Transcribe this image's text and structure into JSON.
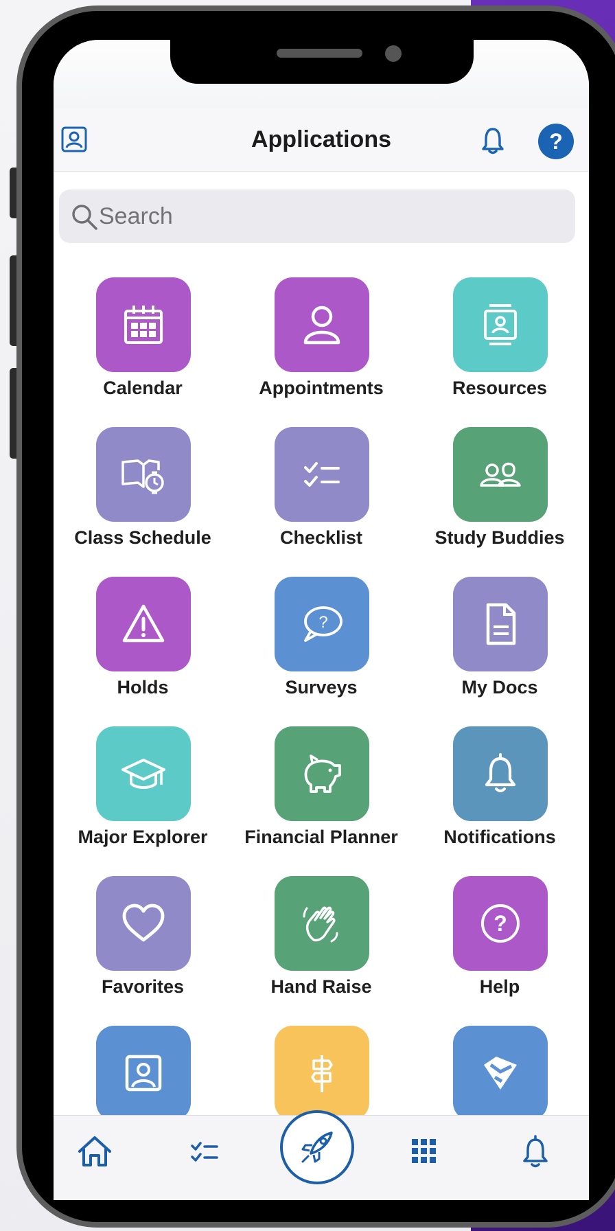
{
  "header": {
    "title": "Applications",
    "profile_icon": "profile-card-icon",
    "bell_icon": "bell-icon",
    "help_label": "?"
  },
  "search": {
    "placeholder": "Search"
  },
  "apps": [
    {
      "label": "Calendar",
      "color": "#ad58c8",
      "icon": "calendar-icon"
    },
    {
      "label": "Appointments",
      "color": "#ad58c8",
      "icon": "person-icon"
    },
    {
      "label": "Resources",
      "color": "#5ccbc7",
      "icon": "resource-card-icon"
    },
    {
      "label": "Class Schedule",
      "color": "#908ac8",
      "icon": "book-clock-icon"
    },
    {
      "label": "Checklist",
      "color": "#908ac8",
      "icon": "checklist-icon"
    },
    {
      "label": "Study Buddies",
      "color": "#57a276",
      "icon": "buddies-icon"
    },
    {
      "label": "Holds",
      "color": "#ad58c8",
      "icon": "warning-triangle-icon"
    },
    {
      "label": "Surveys",
      "color": "#5b91d3",
      "icon": "speech-question-icon"
    },
    {
      "label": "My Docs",
      "color": "#908ac8",
      "icon": "document-icon"
    },
    {
      "label": "Major Explorer",
      "color": "#5ccbc7",
      "icon": "graduation-cap-icon"
    },
    {
      "label": "Financial Planner",
      "color": "#57a276",
      "icon": "piggy-bank-icon"
    },
    {
      "label": "Notifications",
      "color": "#5b95bb",
      "icon": "bell-icon"
    },
    {
      "label": "Favorites",
      "color": "#908ac8",
      "icon": "heart-icon"
    },
    {
      "label": "Hand Raise",
      "color": "#57a276",
      "icon": "raised-hand-icon"
    },
    {
      "label": "Help",
      "color": "#ad58c8",
      "icon": "help-circle-icon"
    },
    {
      "label": "",
      "color": "#5b91d3",
      "icon": "profile-frame-icon"
    },
    {
      "label": "",
      "color": "#f9c35c",
      "icon": "signpost-icon"
    },
    {
      "label": "",
      "color": "#5b91d3",
      "icon": "shield-logo-icon"
    }
  ],
  "tabbar": {
    "items": [
      "home-icon",
      "checklist-icon",
      "rocket-icon",
      "grid-icon",
      "bell-icon"
    ],
    "accent": "#1c5fa8"
  }
}
